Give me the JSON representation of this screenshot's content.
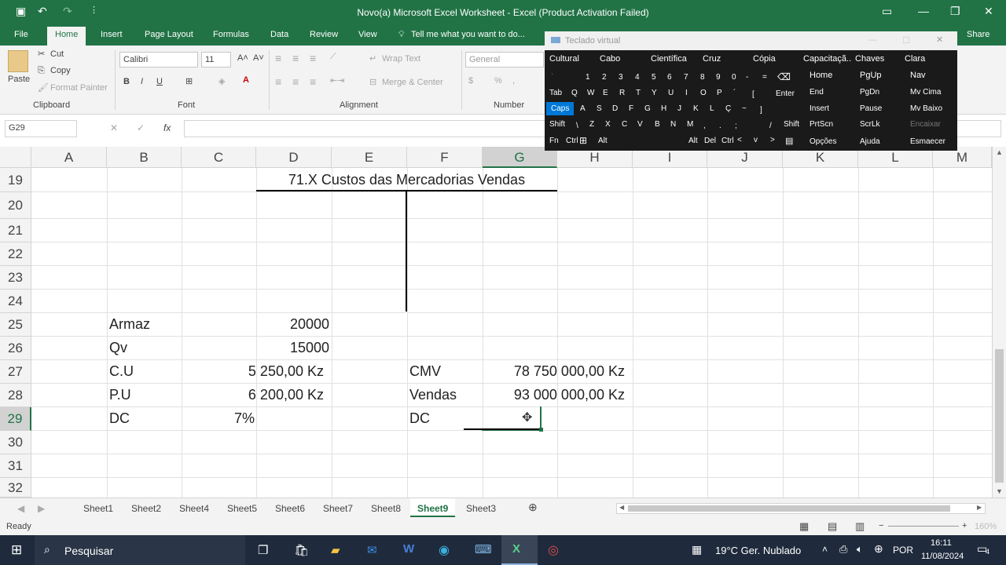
{
  "window": {
    "title": "Novo(a) Microsoft Excel Worksheet - Excel (Product Activation Failed)"
  },
  "menu": {
    "file": "File",
    "home": "Home",
    "insert": "Insert",
    "page_layout": "Page Layout",
    "formulas": "Formulas",
    "data": "Data",
    "review": "Review",
    "view": "View",
    "tell_me": "Tell me what you want to do...",
    "share": "Share"
  },
  "ribbon": {
    "cut": "Cut",
    "copy": "Copy",
    "paste": "Paste",
    "format_painter": "Format Painter",
    "clipboard": "Clipboard",
    "font_name": "Calibri",
    "font_size": "11",
    "bold": "B",
    "italic": "I",
    "underline": "U",
    "font": "Font",
    "wrap_text": "Wrap Text",
    "merge_center": "Merge & Center",
    "alignment": "Alignment",
    "number_format": "General",
    "percent": "%",
    "number": "Number"
  },
  "formula_bar": {
    "name_box": "G29",
    "fx": "fx",
    "formula": ""
  },
  "columns": [
    "A",
    "B",
    "C",
    "D",
    "E",
    "F",
    "G",
    "H",
    "I",
    "J",
    "K",
    "L",
    "M"
  ],
  "rows": [
    "19",
    "20",
    "21",
    "22",
    "23",
    "24",
    "25",
    "26",
    "27",
    "28",
    "29",
    "30",
    "31",
    "32"
  ],
  "cells": {
    "title": "71.X Custos das Mercadorias Vendas",
    "b25": "Armaz",
    "d25": "20000",
    "b26": "Qv",
    "d26": "15000",
    "b27": "C.U",
    "c27": "5 250,00 Kz",
    "f27": "CMV",
    "g27": "78 750 000,00 Kz",
    "b28": "P.U",
    "c28": "6 200,00 Kz",
    "f28": "Vendas",
    "g28": "93 000 000,00 Kz",
    "b29": "DC",
    "c29": "7%",
    "f29": "DC"
  },
  "sheets": [
    "Sheet1",
    "Sheet2",
    "Sheet4",
    "Sheet5",
    "Sheet6",
    "Sheet7",
    "Sheet8",
    "Sheet9",
    "Sheet3"
  ],
  "active_sheet": "Sheet9",
  "status": {
    "ready": "Ready",
    "zoom": "160%"
  },
  "osk": {
    "title": "Teclado virtual",
    "categories": [
      "Cultural",
      "Cabo",
      "Científica",
      "Cruz",
      "Cópia",
      "Capacitaçã..",
      "Chaves",
      "Clara"
    ],
    "row1": [
      "`",
      "1",
      "2",
      "3",
      "4",
      "5",
      "6",
      "7",
      "8",
      "9",
      "0",
      "-",
      "=",
      "⌫"
    ],
    "row2_left": "Tab",
    "row2": [
      "Q",
      "W",
      "E",
      "R",
      "T",
      "Y",
      "U",
      "I",
      "O",
      "P",
      "´",
      "["
    ],
    "enter": "Enter",
    "row3_left": "Caps",
    "row3": [
      "A",
      "S",
      "D",
      "F",
      "G",
      "H",
      "J",
      "K",
      "L",
      "Ç",
      "~",
      "]"
    ],
    "row4_left": "Shift",
    "row4": [
      "\\",
      "Z",
      "X",
      "C",
      "V",
      "B",
      "N",
      "M",
      ",",
      ".",
      ";",
      "/"
    ],
    "row4_right": "Shift",
    "row5": [
      "Fn",
      "Ctrl",
      "⊞",
      "Alt",
      "Alt",
      "Del",
      "Ctrl",
      "<",
      "v",
      ">"
    ],
    "nav": [
      [
        "Home",
        "PgUp",
        "Nav"
      ],
      [
        "End",
        "PgDn",
        "Mv Cima"
      ],
      [
        "Insert",
        "Pause",
        "Mv Baixo"
      ],
      [
        "PrtScn",
        "ScrLk",
        "Encaixar"
      ],
      [
        "Opções",
        "Ajuda",
        "Esmaecer"
      ]
    ]
  },
  "taskbar": {
    "search": "Pesquisar",
    "weather": "19°C  Ger. Nublado",
    "lang": "POR",
    "time": "16:11",
    "date": "11/08/2024",
    "notif": "4"
  },
  "colors": {
    "excel_green": "#217346",
    "osk_bg": "#1a1a1a",
    "caps_active": "#0078d7"
  }
}
